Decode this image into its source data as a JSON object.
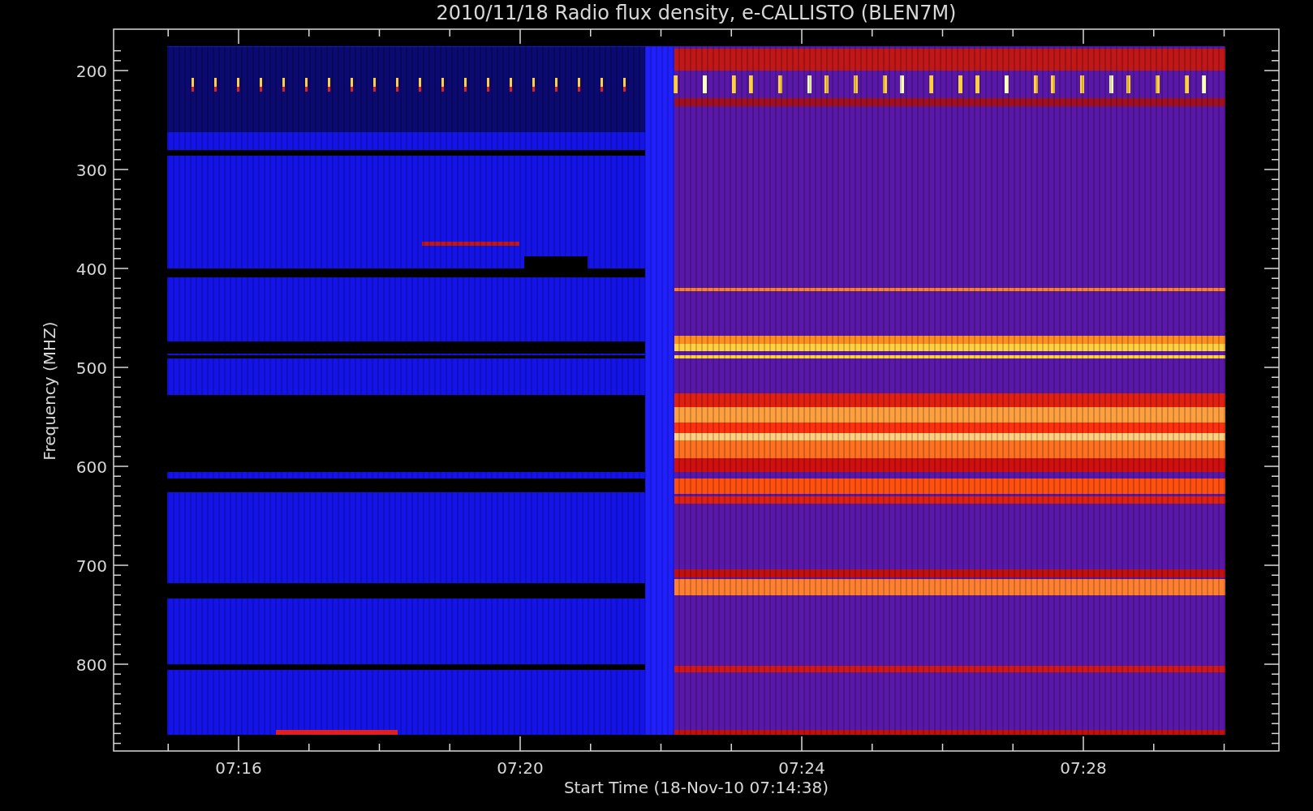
{
  "title": "2010/11/18  Radio flux density, e-CALLISTO (BLEN7M)",
  "y_axis": {
    "label": "Frequency (MHZ)",
    "ticks": [
      "200",
      "300",
      "400",
      "500",
      "600",
      "700",
      "800"
    ]
  },
  "x_axis": {
    "label": "Start Time (18-Nov-10 07:14:38)",
    "ticks": [
      "07:16",
      "07:20",
      "07:24",
      "07:28"
    ]
  }
}
